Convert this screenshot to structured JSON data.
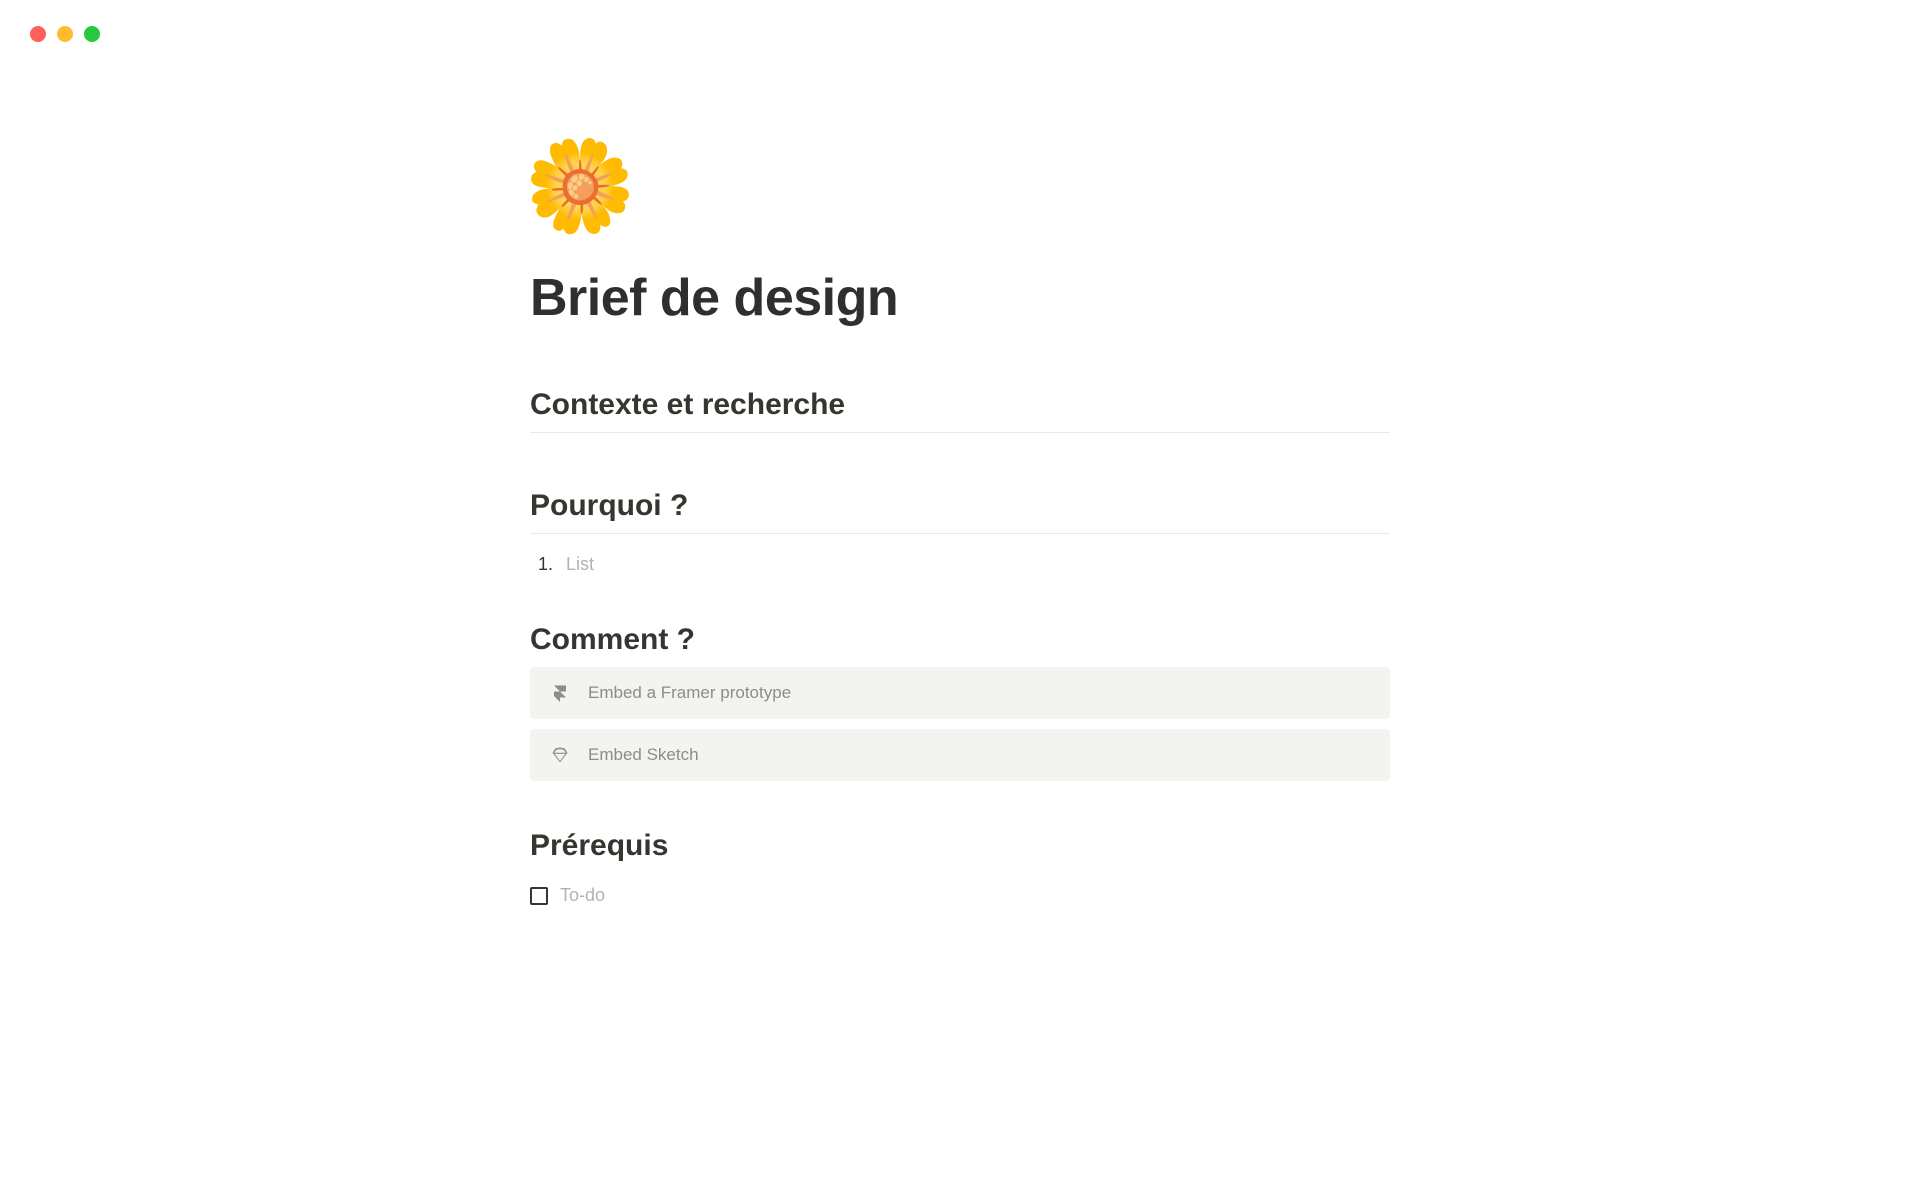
{
  "page": {
    "icon": "🌼",
    "title": "Brief de design"
  },
  "sections": {
    "contexte": {
      "heading": "Contexte et recherche"
    },
    "pourquoi": {
      "heading": "Pourquoi ?",
      "list": {
        "marker": "1.",
        "placeholder": "List"
      }
    },
    "comment": {
      "heading": "Comment ?",
      "embeds": [
        {
          "icon": "framer",
          "label": "Embed a Framer prototype"
        },
        {
          "icon": "sketch",
          "label": "Embed Sketch"
        }
      ]
    },
    "prerequis": {
      "heading": "Prérequis",
      "todo": {
        "placeholder": "To-do"
      }
    }
  }
}
